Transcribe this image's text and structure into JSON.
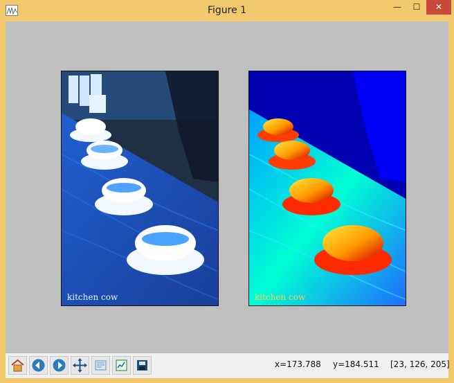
{
  "window": {
    "title": "Figure 1"
  },
  "images": [
    {
      "caption": "kitchen cow"
    },
    {
      "caption": "kitchen cow"
    }
  ],
  "status": {
    "x": "x=173.788",
    "y": "y=184.511",
    "pixel": "[23, 126, 205]"
  },
  "toolbar_icons": [
    "home-icon",
    "back-icon",
    "forward-icon",
    "pan-icon",
    "zoom-icon",
    "subplots-icon",
    "save-icon"
  ]
}
